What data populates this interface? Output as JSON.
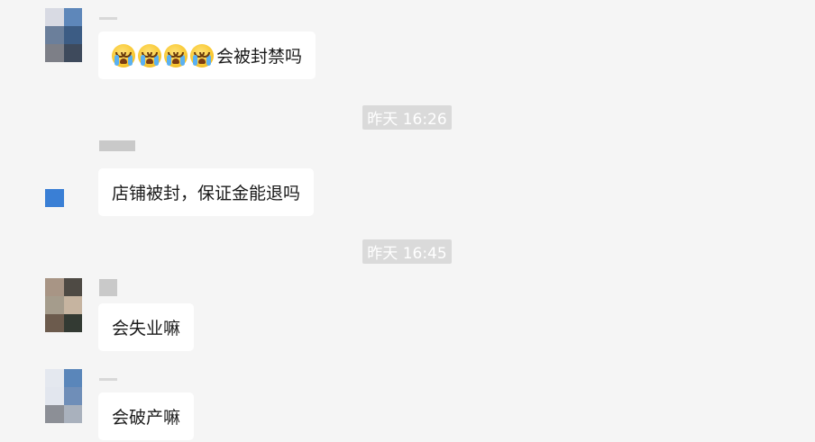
{
  "messages": [
    {
      "text": "会被封禁吗",
      "emojis": [
        "crying-face-icon",
        "crying-face-icon",
        "crying-face-icon",
        "crying-face-icon"
      ]
    },
    {
      "text": "店铺被封，保证金能退吗"
    },
    {
      "text": "会失业嘛"
    },
    {
      "text": "会破产嘛"
    }
  ],
  "timestamps": [
    "昨天 16:26",
    "昨天 16:45"
  ],
  "avatars": [
    [
      "#d8dae3",
      "#5e87ba",
      "#6b7f9b",
      "#3c5c84",
      "#7d7f87",
      "#3e4a5c"
    ],
    [
      "#f5f5f5",
      "#f5f5f5",
      "#f5f5f5",
      "#f5f5f5",
      "#3a7fd5",
      "#f5f5f5"
    ],
    [
      "#a89585",
      "#4e4a44",
      "#a59c8c",
      "#c6b4a0",
      "#6c5b4d",
      "#333a33"
    ],
    [
      "#e4e8ef",
      "#5a86ba",
      "#e2e6ee",
      "#6f8eb8",
      "#8c8f96",
      "#a9b1bd"
    ]
  ]
}
